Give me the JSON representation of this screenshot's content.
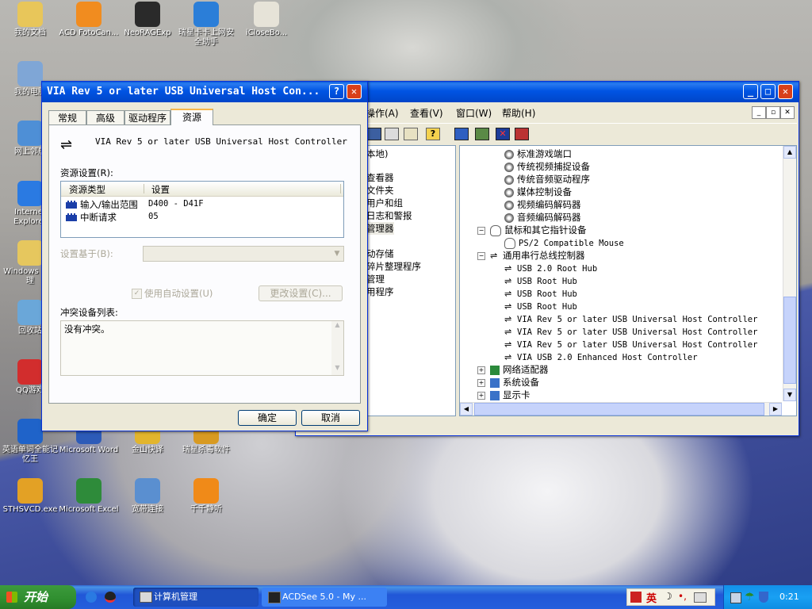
{
  "desktop": {
    "icons": [
      {
        "label": "我的文档",
        "icon": "documents-folder-icon",
        "color": "#e8c65a"
      },
      {
        "label": "ACD FotoCan...",
        "icon": "acd-fotocanvas-icon",
        "color": "#f18c1f"
      },
      {
        "label": "NeoRAGExp",
        "icon": "neorage-icon",
        "color": "#2a2a2a"
      },
      {
        "label": "瑞星卡卡上网安全助手",
        "icon": "rising-kaka-icon",
        "color": "#2b7ed8"
      },
      {
        "label": "iCloseBo...",
        "icon": "iclosebox-icon",
        "color": "#e6e3d8"
      },
      {
        "label": "我的电脑",
        "icon": "my-computer-icon",
        "color": "#7fa6d6"
      },
      {
        "label": "网上邻居",
        "icon": "network-places-icon",
        "color": "#4e8fd6"
      },
      {
        "label": "Internet Explorer",
        "icon": "internet-explorer-icon",
        "color": "#2a7ae2"
      },
      {
        "label": "Windows 源管理",
        "icon": "windows-explorer-icon",
        "color": "#e6c75e"
      },
      {
        "label": "回收站",
        "icon": "recycle-bin-icon",
        "color": "#6aa7d9"
      },
      {
        "label": "QQ游戏",
        "icon": "qq-game-icon",
        "color": "#d22d2d"
      },
      {
        "label": "英语单词全能记忆王",
        "icon": "english-words-icon",
        "color": "#1f63c9"
      },
      {
        "label": "Microsoft Word",
        "icon": "word-icon",
        "color": "#2d5bb8"
      },
      {
        "label": "金山快译",
        "icon": "kingsoft-translate-icon",
        "color": "#e2b52d"
      },
      {
        "label": "瑞星杀毒软件",
        "icon": "rising-antivirus-icon",
        "color": "#d89a22"
      },
      {
        "label": "STHSVCD.exe",
        "icon": "sthsvcd-icon",
        "color": "#e3a125"
      },
      {
        "label": "Microsoft Excel",
        "icon": "excel-icon",
        "color": "#2e8b3a"
      },
      {
        "label": "宽带连接",
        "icon": "broadband-connection-icon",
        "color": "#5a8fd0"
      },
      {
        "label": "千千静听",
        "icon": "ttplayer-icon",
        "color": "#f08a18"
      }
    ]
  },
  "mmc": {
    "menu": [
      "操作(A)",
      "查看(V)",
      "窗口(W)",
      "帮助(H)"
    ],
    "left_tree": [
      "本地)",
      "查看器",
      "文件夹",
      "用户和组",
      "日志和警报",
      "管理器",
      "动存储",
      "碎片整理程序",
      "管理",
      "用程序"
    ],
    "right_tree": [
      {
        "label": "标准游戏端口",
        "level": 2,
        "kind": "device"
      },
      {
        "label": "传统视频捕捉设备",
        "level": 2,
        "kind": "device"
      },
      {
        "label": "传统音频驱动程序",
        "level": 2,
        "kind": "device"
      },
      {
        "label": "媒体控制设备",
        "level": 2,
        "kind": "device"
      },
      {
        "label": "视频编码解码器",
        "level": 2,
        "kind": "device"
      },
      {
        "label": "音频编码解码器",
        "level": 2,
        "kind": "device"
      },
      {
        "label": "鼠标和其它指针设备",
        "level": 1,
        "kind": "mouse",
        "expander": "−"
      },
      {
        "label": "PS/2 Compatible Mouse",
        "level": 2,
        "kind": "mouse"
      },
      {
        "label": "通用串行总线控制器",
        "level": 1,
        "kind": "usb",
        "expander": "−"
      },
      {
        "label": "USB 2.0 Root Hub",
        "level": 2,
        "kind": "usb"
      },
      {
        "label": "USB Root Hub",
        "level": 2,
        "kind": "usb"
      },
      {
        "label": "USB Root Hub",
        "level": 2,
        "kind": "usb"
      },
      {
        "label": "USB Root Hub",
        "level": 2,
        "kind": "usb"
      },
      {
        "label": "VIA Rev 5 or later USB Universal Host Controller",
        "level": 2,
        "kind": "usb"
      },
      {
        "label": "VIA Rev 5 or later USB Universal Host Controller",
        "level": 2,
        "kind": "usb"
      },
      {
        "label": "VIA Rev 5 or later USB Universal Host Controller",
        "level": 2,
        "kind": "usb"
      },
      {
        "label": "VIA USB 2.0 Enhanced Host Controller",
        "level": 2,
        "kind": "usb"
      },
      {
        "label": "网络适配器",
        "level": 1,
        "kind": "network",
        "expander": "+"
      },
      {
        "label": "系统设备",
        "level": 1,
        "kind": "system",
        "expander": "+"
      },
      {
        "label": "显示卡",
        "level": 1,
        "kind": "display",
        "expander": "+"
      }
    ]
  },
  "dialog": {
    "title": "VIA Rev 5 or later USB Universal Host Con...",
    "tabs": [
      "常规",
      "高级",
      "驱动程序",
      "资源"
    ],
    "active_tab": "资源",
    "device_name": "VIA Rev 5 or later USB Universal Host Controller",
    "resource_settings_label": "资源设置(R):",
    "col_type": "资源类型",
    "col_setting": "设置",
    "resources": [
      {
        "type": "输入/输出范围",
        "setting": "D400 - D41F"
      },
      {
        "type": "中断请求",
        "setting": "05"
      }
    ],
    "based_on_label": "设置基于(B):",
    "auto_settings_label": "使用自动设置(U)",
    "auto_settings_checked": true,
    "change_button": "更改设置(C)...",
    "conflict_label": "冲突设备列表:",
    "conflict_text": "没有冲突。",
    "ok": "确定",
    "cancel": "取消"
  },
  "taskbar": {
    "start": "开始",
    "tasks": [
      "计算机管理",
      "ACDSee 5.0 - My ..."
    ],
    "ime": "英",
    "clock": "0:21"
  }
}
